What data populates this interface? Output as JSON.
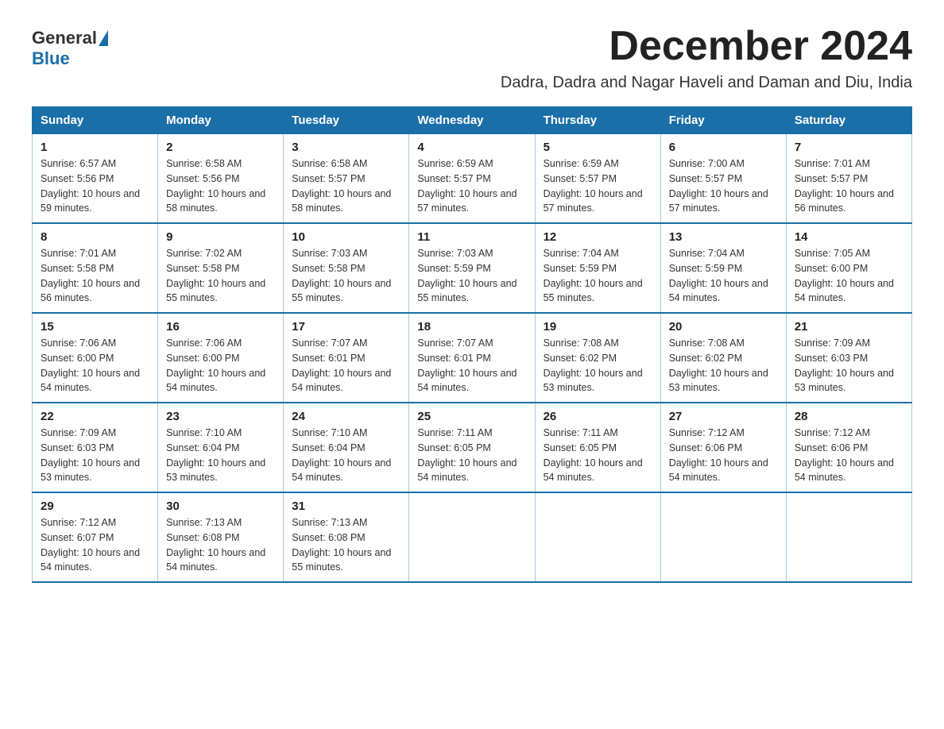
{
  "logo": {
    "general": "General",
    "blue": "Blue"
  },
  "title": "December 2024",
  "subtitle": "Dadra, Dadra and Nagar Haveli and Daman and Diu, India",
  "days_of_week": [
    "Sunday",
    "Monday",
    "Tuesday",
    "Wednesday",
    "Thursday",
    "Friday",
    "Saturday"
  ],
  "weeks": [
    [
      {
        "day": "1",
        "sunrise": "6:57 AM",
        "sunset": "5:56 PM",
        "daylight": "10 hours and 59 minutes."
      },
      {
        "day": "2",
        "sunrise": "6:58 AM",
        "sunset": "5:56 PM",
        "daylight": "10 hours and 58 minutes."
      },
      {
        "day": "3",
        "sunrise": "6:58 AM",
        "sunset": "5:57 PM",
        "daylight": "10 hours and 58 minutes."
      },
      {
        "day": "4",
        "sunrise": "6:59 AM",
        "sunset": "5:57 PM",
        "daylight": "10 hours and 57 minutes."
      },
      {
        "day": "5",
        "sunrise": "6:59 AM",
        "sunset": "5:57 PM",
        "daylight": "10 hours and 57 minutes."
      },
      {
        "day": "6",
        "sunrise": "7:00 AM",
        "sunset": "5:57 PM",
        "daylight": "10 hours and 57 minutes."
      },
      {
        "day": "7",
        "sunrise": "7:01 AM",
        "sunset": "5:57 PM",
        "daylight": "10 hours and 56 minutes."
      }
    ],
    [
      {
        "day": "8",
        "sunrise": "7:01 AM",
        "sunset": "5:58 PM",
        "daylight": "10 hours and 56 minutes."
      },
      {
        "day": "9",
        "sunrise": "7:02 AM",
        "sunset": "5:58 PM",
        "daylight": "10 hours and 55 minutes."
      },
      {
        "day": "10",
        "sunrise": "7:03 AM",
        "sunset": "5:58 PM",
        "daylight": "10 hours and 55 minutes."
      },
      {
        "day": "11",
        "sunrise": "7:03 AM",
        "sunset": "5:59 PM",
        "daylight": "10 hours and 55 minutes."
      },
      {
        "day": "12",
        "sunrise": "7:04 AM",
        "sunset": "5:59 PM",
        "daylight": "10 hours and 55 minutes."
      },
      {
        "day": "13",
        "sunrise": "7:04 AM",
        "sunset": "5:59 PM",
        "daylight": "10 hours and 54 minutes."
      },
      {
        "day": "14",
        "sunrise": "7:05 AM",
        "sunset": "6:00 PM",
        "daylight": "10 hours and 54 minutes."
      }
    ],
    [
      {
        "day": "15",
        "sunrise": "7:06 AM",
        "sunset": "6:00 PM",
        "daylight": "10 hours and 54 minutes."
      },
      {
        "day": "16",
        "sunrise": "7:06 AM",
        "sunset": "6:00 PM",
        "daylight": "10 hours and 54 minutes."
      },
      {
        "day": "17",
        "sunrise": "7:07 AM",
        "sunset": "6:01 PM",
        "daylight": "10 hours and 54 minutes."
      },
      {
        "day": "18",
        "sunrise": "7:07 AM",
        "sunset": "6:01 PM",
        "daylight": "10 hours and 54 minutes."
      },
      {
        "day": "19",
        "sunrise": "7:08 AM",
        "sunset": "6:02 PM",
        "daylight": "10 hours and 53 minutes."
      },
      {
        "day": "20",
        "sunrise": "7:08 AM",
        "sunset": "6:02 PM",
        "daylight": "10 hours and 53 minutes."
      },
      {
        "day": "21",
        "sunrise": "7:09 AM",
        "sunset": "6:03 PM",
        "daylight": "10 hours and 53 minutes."
      }
    ],
    [
      {
        "day": "22",
        "sunrise": "7:09 AM",
        "sunset": "6:03 PM",
        "daylight": "10 hours and 53 minutes."
      },
      {
        "day": "23",
        "sunrise": "7:10 AM",
        "sunset": "6:04 PM",
        "daylight": "10 hours and 53 minutes."
      },
      {
        "day": "24",
        "sunrise": "7:10 AM",
        "sunset": "6:04 PM",
        "daylight": "10 hours and 54 minutes."
      },
      {
        "day": "25",
        "sunrise": "7:11 AM",
        "sunset": "6:05 PM",
        "daylight": "10 hours and 54 minutes."
      },
      {
        "day": "26",
        "sunrise": "7:11 AM",
        "sunset": "6:05 PM",
        "daylight": "10 hours and 54 minutes."
      },
      {
        "day": "27",
        "sunrise": "7:12 AM",
        "sunset": "6:06 PM",
        "daylight": "10 hours and 54 minutes."
      },
      {
        "day": "28",
        "sunrise": "7:12 AM",
        "sunset": "6:06 PM",
        "daylight": "10 hours and 54 minutes."
      }
    ],
    [
      {
        "day": "29",
        "sunrise": "7:12 AM",
        "sunset": "6:07 PM",
        "daylight": "10 hours and 54 minutes."
      },
      {
        "day": "30",
        "sunrise": "7:13 AM",
        "sunset": "6:08 PM",
        "daylight": "10 hours and 54 minutes."
      },
      {
        "day": "31",
        "sunrise": "7:13 AM",
        "sunset": "6:08 PM",
        "daylight": "10 hours and 55 minutes."
      },
      null,
      null,
      null,
      null
    ]
  ]
}
